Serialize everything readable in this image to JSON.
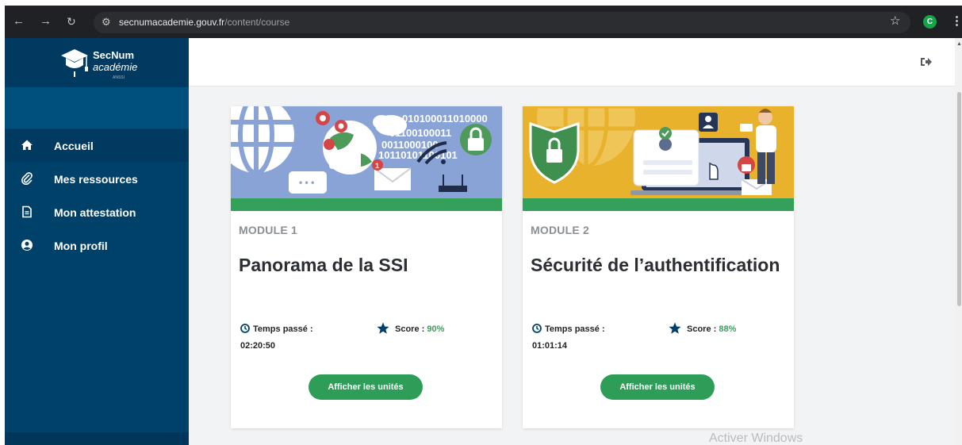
{
  "browser": {
    "url_domain": "secnumacademie.gouv.fr",
    "url_path": "/content/course",
    "profile_initial": "C"
  },
  "logo": {
    "line1": "SecNum",
    "line2": "académie",
    "line3": "ANSSI"
  },
  "sidebar": {
    "items": [
      {
        "label": "Accueil",
        "icon": "home-icon"
      },
      {
        "label": "Mes ressources",
        "icon": "paperclip-icon"
      },
      {
        "label": "Mon attestation",
        "icon": "document-icon"
      },
      {
        "label": "Mon profil",
        "icon": "user-circle-icon"
      }
    ],
    "active_index": 0
  },
  "cards": [
    {
      "module": "MODULE 1",
      "title": "Panorama de la SSI",
      "time_label": "Temps passé :",
      "time_value": "02:20:50",
      "score_label": "Score :",
      "score_value": "90%",
      "button_label": "Afficher les unités",
      "banner_bg": "#8aa3d6",
      "banner_text": "010100011010000"
    },
    {
      "module": "MODULE 2",
      "title": "Sécurité de l’authentification",
      "time_label": "Temps passé :",
      "time_value": "01:01:14",
      "score_label": "Score :",
      "score_value": "88%",
      "button_label": "Afficher les unités",
      "banner_bg": "#e8b22c"
    }
  ],
  "watermark": "Activer Windows",
  "colors": {
    "sidebar": "#00416a",
    "accent_green": "#33a15a",
    "button_green": "#2e9d58",
    "content_bg": "#f2f3f4"
  }
}
